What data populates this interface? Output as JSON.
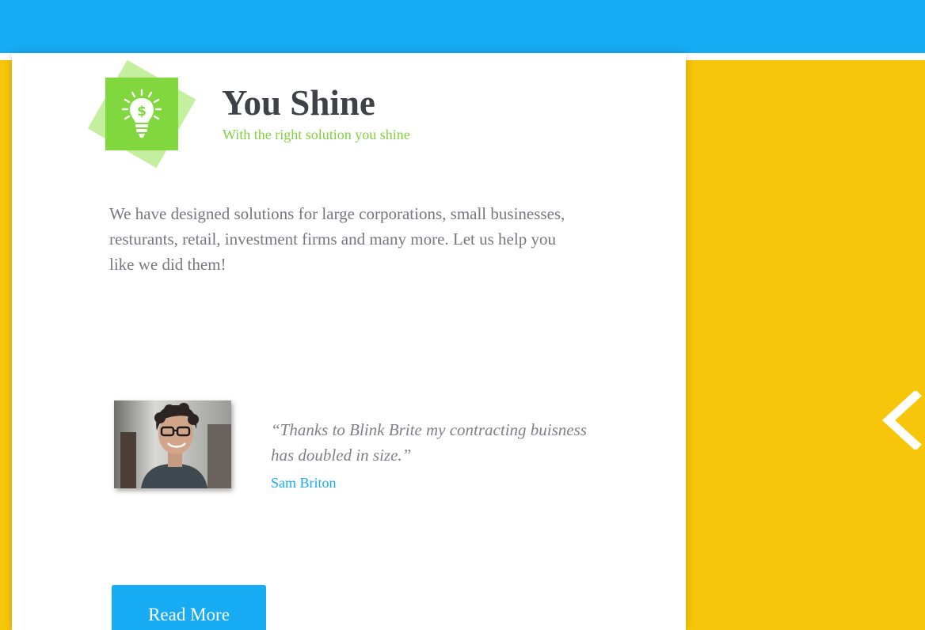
{
  "feature": {
    "icon": "lightbulb-dollar-icon",
    "title": "You Shine",
    "subtitle": "With the right solution you shine",
    "description": "We have designed solutions for large corporations, small businesses, resturants, retail, investment firms and many more. Let us help you like we did them!"
  },
  "testimonial": {
    "quote": "“Thanks to Blink Brite my contracting buisness has doubled in size.”",
    "author": "Sam Briton",
    "avatar_alt": "Sam Briton"
  },
  "actions": {
    "read_more_label": "Read More",
    "prev_arrow_icon": "chevron-left-icon"
  },
  "colors": {
    "top_bar": "#16abf3",
    "background": "#f7c60a",
    "accent_green": "#80d73e",
    "accent_blue": "#16abf3",
    "title": "#404048",
    "body": "#77777d"
  }
}
